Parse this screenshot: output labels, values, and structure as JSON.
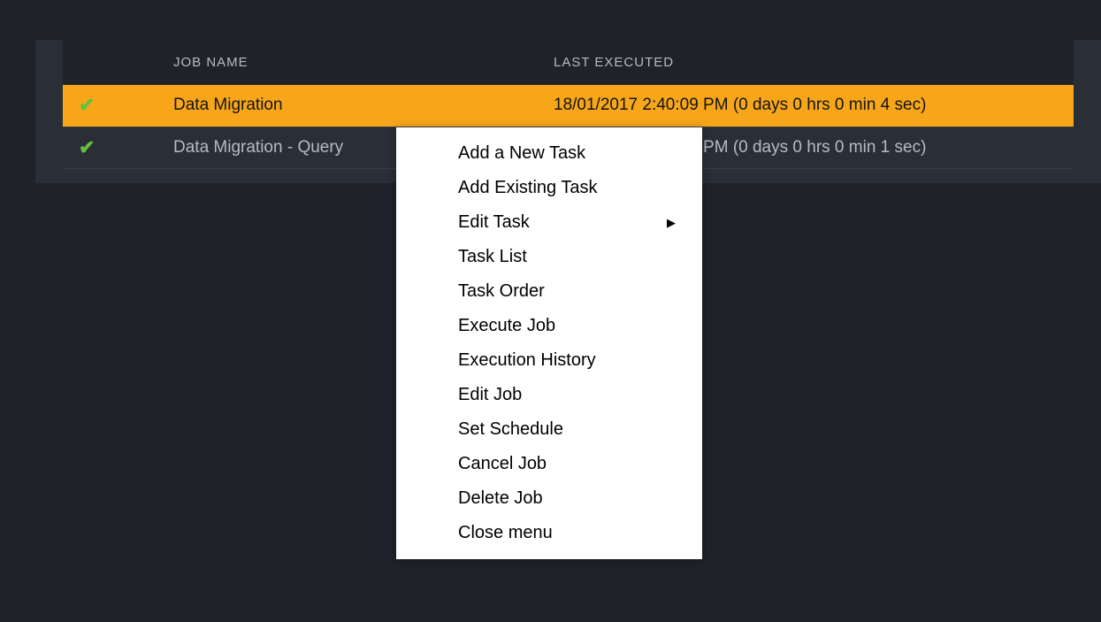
{
  "table": {
    "headers": {
      "status": "",
      "name": "JOB NAME",
      "executed": "LAST EXECUTED"
    },
    "rows": [
      {
        "status_icon": "check-icon",
        "name": "Data Migration",
        "executed": "18/01/2017 2:40:09 PM (0 days 0 hrs 0 min 4 sec)",
        "selected": true
      },
      {
        "status_icon": "check-icon",
        "name": "Data Migration - Query",
        "executed": "18/01/2017 2:46:29 PM (0 days 0 hrs 0 min 1 sec)",
        "selected": false
      }
    ]
  },
  "context_menu": {
    "items": [
      {
        "label": "Add a New Task",
        "submenu": false
      },
      {
        "label": "Add Existing Task",
        "submenu": false
      },
      {
        "label": "Edit Task",
        "submenu": true
      },
      {
        "label": "Task List",
        "submenu": false
      },
      {
        "label": "Task Order",
        "submenu": false
      },
      {
        "label": "Execute Job",
        "submenu": false
      },
      {
        "label": "Execution History",
        "submenu": false
      },
      {
        "label": "Edit Job",
        "submenu": false
      },
      {
        "label": "Set Schedule",
        "submenu": false
      },
      {
        "label": "Cancel Job",
        "submenu": false
      },
      {
        "label": "Delete Job",
        "submenu": false
      },
      {
        "label": "Close menu",
        "submenu": false
      }
    ]
  },
  "icons": {
    "check": "✔",
    "arrow_right": "▶"
  }
}
